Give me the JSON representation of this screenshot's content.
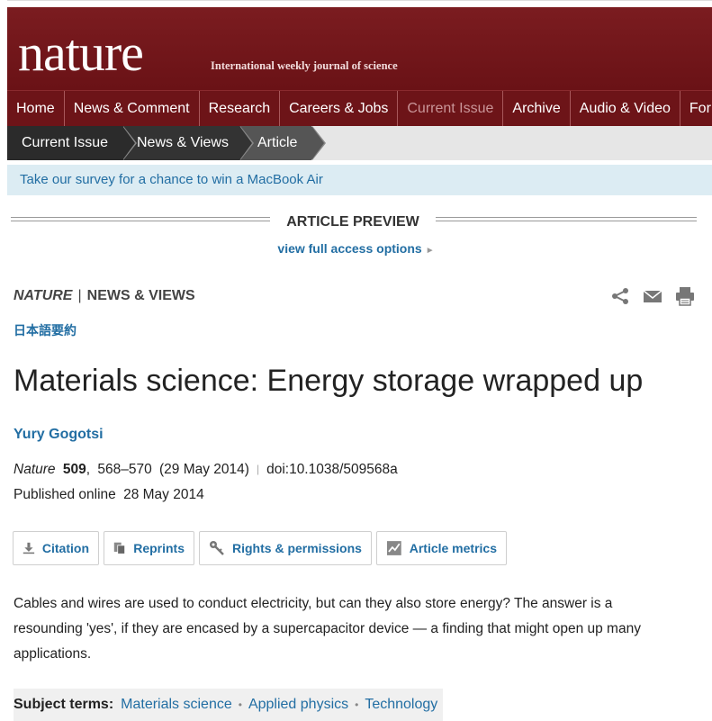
{
  "brand": {
    "logo": "nature",
    "tagline": "International weekly journal of science"
  },
  "nav": {
    "items": [
      "Home",
      "News & Comment",
      "Research",
      "Careers & Jobs",
      "Current Issue",
      "Archive",
      "Audio & Video",
      "For"
    ],
    "current": "Current Issue"
  },
  "breadcrumb": [
    "Current Issue",
    "News & Views",
    "Article"
  ],
  "survey": {
    "text": "Take our survey for a chance to win a MacBook Air"
  },
  "preview": {
    "title": "ARTICLE PREVIEW",
    "link": "view full access options",
    "link_arrow": "►"
  },
  "section": {
    "journal": "NATURE",
    "separator": "|",
    "type": "NEWS & VIEWS"
  },
  "tools": {
    "icons": [
      "share-icon",
      "email-icon",
      "print-icon"
    ]
  },
  "japanese_summary": "日本語要約",
  "article": {
    "title": "Materials science: Energy storage wrapped up",
    "author": "Yury Gogotsi",
    "journal": "Nature",
    "volume": "509",
    "pages": "568–570",
    "date": "(29 May 2014)",
    "separator": "|",
    "doi": "doi:10.1038/509568a",
    "published_label": "Published online",
    "published_date": "28 May 2014",
    "abstract": "Cables and wires are used to conduct electricity, but can they also store energy? The answer is a resounding 'yes', if they are encased by a supercapacitor device — a finding that might open up many applications."
  },
  "buttons": {
    "citation": "Citation",
    "reprints": "Reprints",
    "rights": "Rights & permissions",
    "metrics": "Article metrics"
  },
  "subject_terms": {
    "label": "Subject terms:",
    "terms": [
      "Materials science",
      "Applied physics",
      "Technology"
    ],
    "separator": "•"
  },
  "colors": {
    "masthead": "#7b1c20",
    "link": "#226ea3",
    "survey_bg": "#dcecf3"
  }
}
